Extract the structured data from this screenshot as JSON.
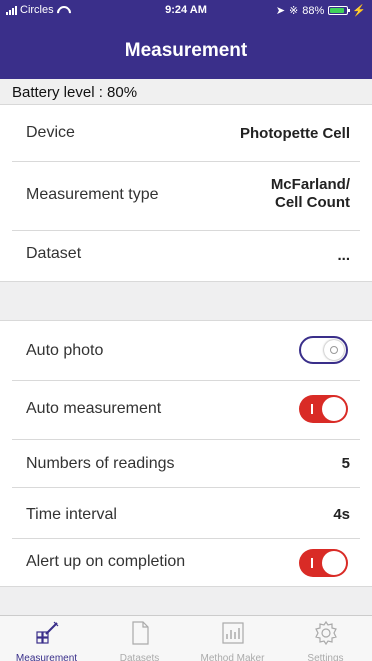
{
  "status_bar": {
    "carrier": "Circles",
    "time": "9:24 AM",
    "battery_percent": "88%",
    "battery_level": 0.88
  },
  "nav": {
    "title": "Measurement"
  },
  "banner": {
    "battery_text": "Battery level : 80%"
  },
  "device_section": {
    "device_label": "Device",
    "device_value": "Photopette Cell",
    "type_label": "Measurement type",
    "type_value_line1": "McFarland/",
    "type_value_line2": "Cell Count",
    "dataset_label": "Dataset",
    "dataset_value": "..."
  },
  "settings_section": {
    "auto_photo_label": "Auto photo",
    "auto_photo_on": false,
    "auto_measurement_label": "Auto measurement",
    "auto_measurement_on": true,
    "readings_label": "Numbers of readings",
    "readings_value": "5",
    "interval_label": "Time interval",
    "interval_value": "4s",
    "alert_label": "Alert up on completion",
    "alert_on": true
  },
  "tabs": [
    {
      "label": "Measurement",
      "icon": "measurement-pencil-icon",
      "active": true
    },
    {
      "label": "Datasets",
      "icon": "document-icon",
      "active": false
    },
    {
      "label": "Method Maker",
      "icon": "chart-icon",
      "active": false
    },
    {
      "label": "Settings",
      "icon": "gear-icon",
      "active": false
    }
  ],
  "colors": {
    "nav_bg": "#3a2f8a",
    "toggle_on": "#d92b26",
    "battery_fill": "#3fd25a"
  }
}
